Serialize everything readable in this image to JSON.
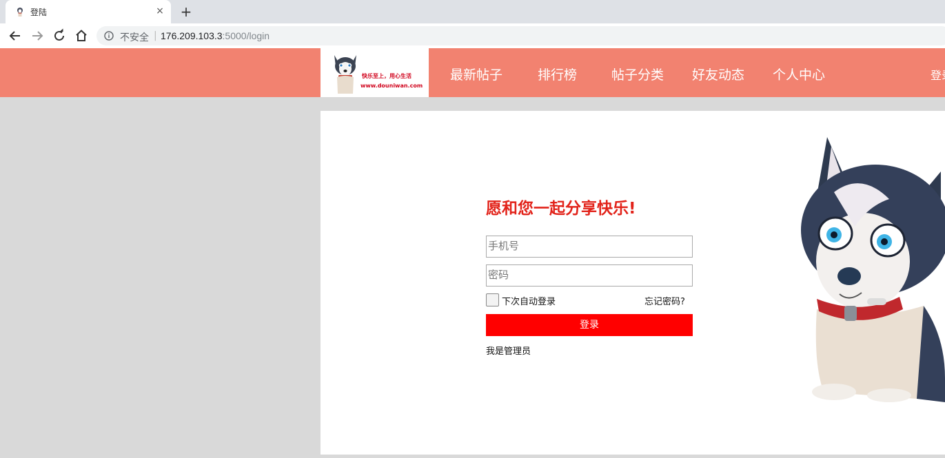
{
  "browser": {
    "tab_title": "登陆",
    "new_tab_symbol": "+",
    "close_symbol": "×",
    "security_label": "不安全",
    "url_host": "176.209.103.3",
    "url_path": ":5000/login"
  },
  "header": {
    "logo": {
      "slogan": "快乐至上，用心生活",
      "url": "www.douniwan.com"
    },
    "nav": [
      {
        "label": "最新帖子"
      },
      {
        "label": "排行榜"
      },
      {
        "label": "帖子分类"
      },
      {
        "label": "好友动态"
      },
      {
        "label": "个人中心"
      }
    ],
    "login_label": "登录"
  },
  "login": {
    "slogan": "愿和您一起分享快乐!",
    "phone_placeholder": "手机号",
    "password_placeholder": "密码",
    "remember_label": "下次自动登录",
    "forgot_label": "忘记密码?",
    "submit_label": "登录",
    "admin_label": "我是管理员"
  },
  "colors": {
    "header_bg": "#f28270",
    "accent_red": "#ff0000",
    "slogan_red": "#e2231a",
    "page_bg": "#d9d9d9"
  }
}
